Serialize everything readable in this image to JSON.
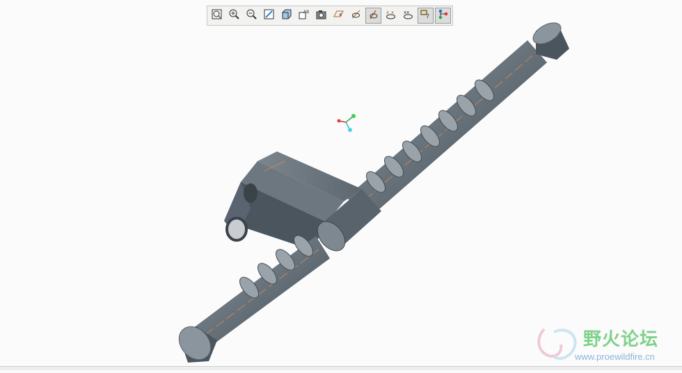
{
  "toolbar": {
    "buttons": [
      {
        "icon": "zoom-fit-icon",
        "active": false
      },
      {
        "icon": "zoom-in-icon",
        "active": false
      },
      {
        "icon": "zoom-out-icon",
        "active": false
      },
      {
        "icon": "repaint-icon",
        "active": false
      },
      {
        "icon": "display-style-icon",
        "active": false
      },
      {
        "icon": "saved-views-icon",
        "active": false
      },
      {
        "icon": "camera-icon",
        "active": false
      },
      {
        "icon": "datum-planes-icon",
        "active": false
      },
      {
        "icon": "datum-axes-icon",
        "active": false
      },
      {
        "icon": "datum-points-icon",
        "active": true
      },
      {
        "icon": "csys-icon",
        "active": false
      },
      {
        "icon": "annotations-icon",
        "active": false
      },
      {
        "icon": "spin-center-icon",
        "active": true
      },
      {
        "icon": "model-tree-icon",
        "active": true
      }
    ]
  },
  "colors": {
    "part": "#5e6a74",
    "axis": "#c8865a",
    "background": "#fbfbfb"
  },
  "watermark": {
    "cn": "野火论坛",
    "url": "www.proewildfire.cn"
  }
}
